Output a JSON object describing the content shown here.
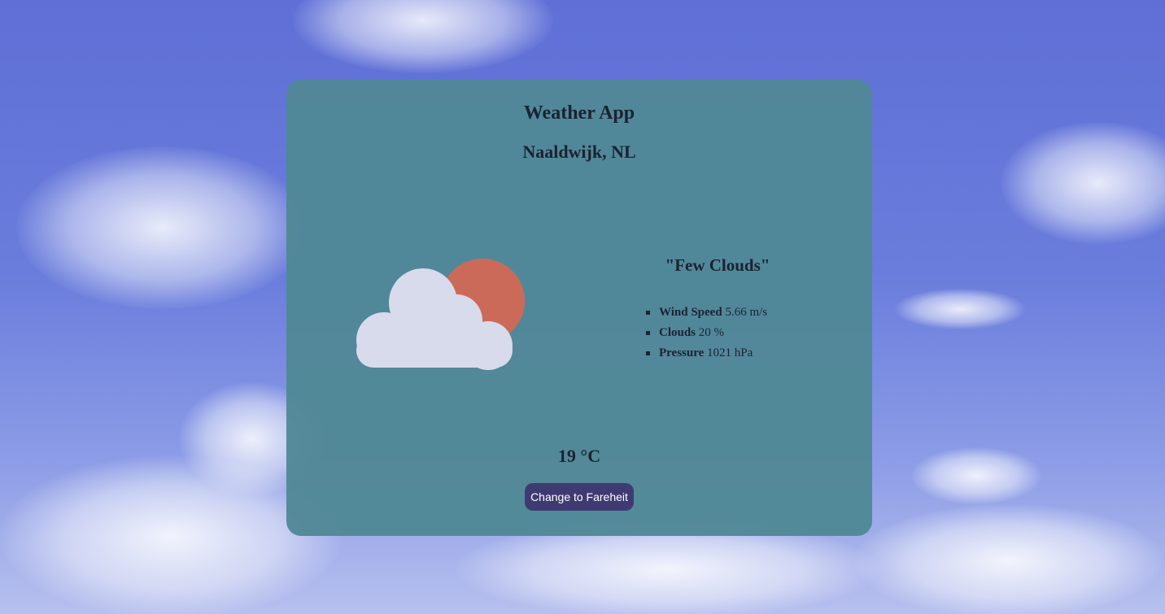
{
  "app": {
    "title": "Weather App",
    "location": "Naaldwijk, NL"
  },
  "weather": {
    "description": "\"Few Clouds\"",
    "icon": "few-clouds-day-icon",
    "temperature": "19 °C",
    "stats": [
      {
        "label": "Wind Speed",
        "value": "5.66 m/s"
      },
      {
        "label": "Clouds",
        "value": "20 %"
      },
      {
        "label": "Pressure",
        "value": "1021 hPa"
      }
    ]
  },
  "actions": {
    "convert_label": "Change to Fareheit"
  },
  "colors": {
    "card_bg": "#508896",
    "button_bg": "#3f3b72",
    "sun": "#cc6a5a",
    "cloud": "#d8dbec",
    "sky": "#6a7ddc"
  }
}
